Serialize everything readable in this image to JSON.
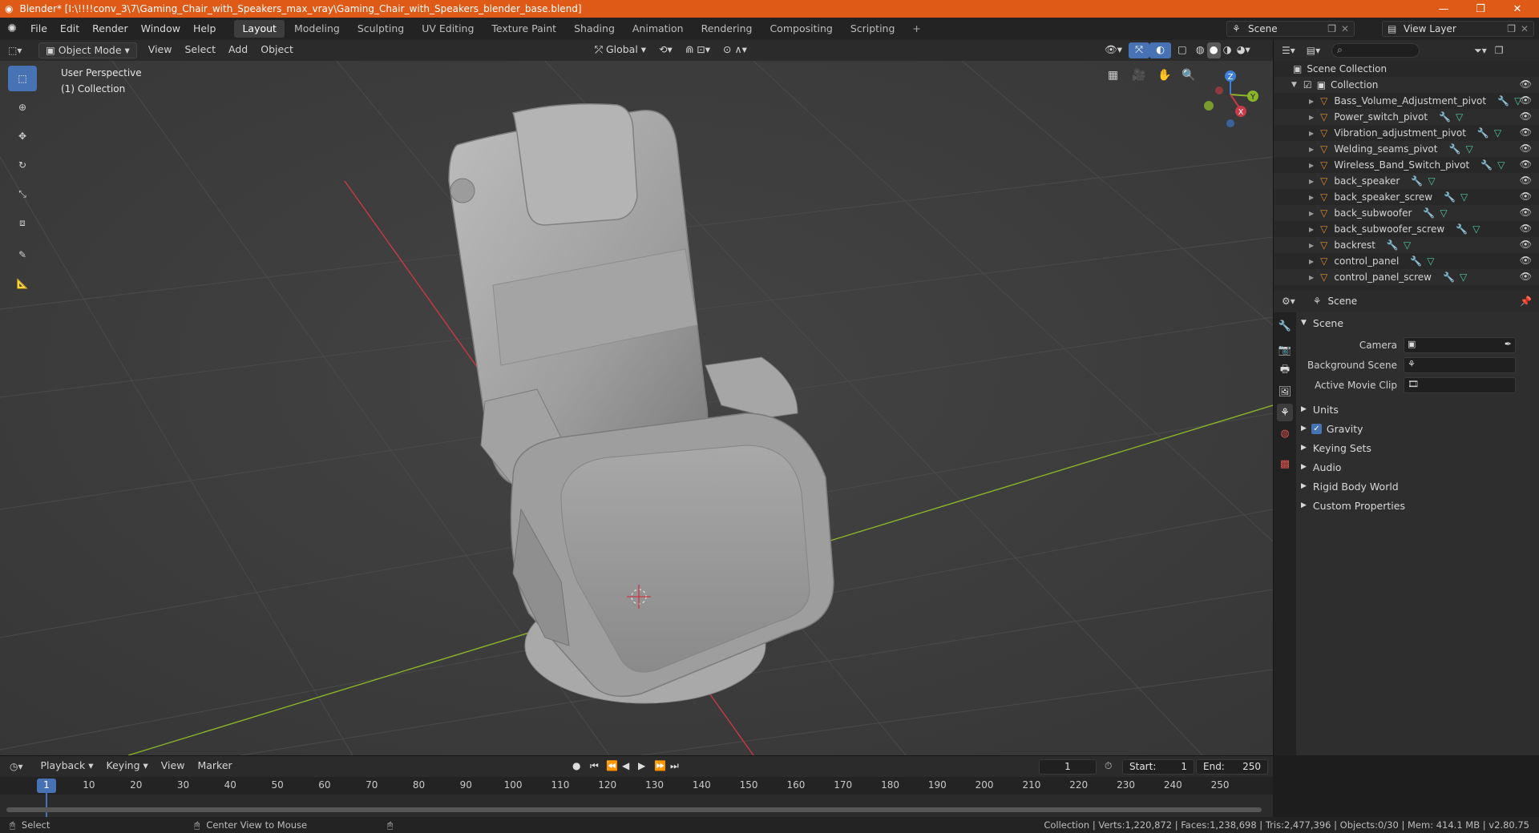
{
  "window": {
    "title": "Blender* [I:\\!!!!conv_3\\7\\Gaming_Chair_with_Speakers_max_vray\\Gaming_Chair_with_Speakers_blender_base.blend]",
    "minimize": "—",
    "restore": "❐",
    "close": "✕"
  },
  "menu": [
    "File",
    "Edit",
    "Render",
    "Window",
    "Help"
  ],
  "workspaces": [
    {
      "label": "Layout",
      "active": true
    },
    {
      "label": "Modeling"
    },
    {
      "label": "Sculpting"
    },
    {
      "label": "UV Editing"
    },
    {
      "label": "Texture Paint"
    },
    {
      "label": "Shading"
    },
    {
      "label": "Animation"
    },
    {
      "label": "Rendering"
    },
    {
      "label": "Compositing"
    },
    {
      "label": "Scripting"
    }
  ],
  "add_workspace": "+",
  "scene_selector": "Scene",
  "view_layer": "View Layer",
  "viewport_header": {
    "mode": "Object Mode",
    "menus": [
      "View",
      "Select",
      "Add",
      "Object"
    ],
    "orientation": "Global"
  },
  "viewport": {
    "perspective": "User Perspective",
    "collection": "(1) Collection",
    "gizmo": {
      "x": "X",
      "y": "Y",
      "z": "Z"
    }
  },
  "outliner": {
    "search_placeholder": "",
    "root": "Scene Collection",
    "collection": "Collection",
    "items": [
      "Bass_Volume_Adjustment_pivot",
      "Power_switch_pivot",
      "Vibration_adjustment_pivot",
      "Welding_seams_pivot",
      "Wireless_Band_Switch_pivot",
      "back_speaker",
      "back_speaker_screw",
      "back_subwoofer",
      "back_subwoofer_screw",
      "backrest",
      "control_panel",
      "control_panel_screw"
    ]
  },
  "properties": {
    "context": "Scene",
    "panel_title": "Scene",
    "camera_label": "Camera",
    "background_scene_label": "Background Scene",
    "active_movie_clip_label": "Active Movie Clip",
    "subpanels": [
      "Units",
      "Gravity",
      "Keying Sets",
      "Audio",
      "Rigid Body World",
      "Custom Properties"
    ],
    "gravity_enabled": true
  },
  "timeline": {
    "menus": [
      "Playback",
      "Keying",
      "View",
      "Marker"
    ],
    "current_frame": "1",
    "start_label": "Start:",
    "start": "1",
    "end_label": "End:",
    "end": "250",
    "ticks": [
      "1",
      "10",
      "20",
      "30",
      "40",
      "50",
      "60",
      "70",
      "80",
      "90",
      "100",
      "110",
      "120",
      "130",
      "140",
      "150",
      "160",
      "170",
      "180",
      "190",
      "200",
      "210",
      "220",
      "230",
      "240",
      "250"
    ]
  },
  "statusbar": {
    "select": "Select",
    "center_view": "Center View to Mouse",
    "stats": "Collection | Verts:1,220,872 | Faces:1,238,698 | Tris:2,477,396 | Objects:0/30 | Mem: 414.1 MB | v2.80.75"
  },
  "colors": {
    "titlebar": "#e05a17",
    "accent": "#4772b3",
    "x_axis": "#c83a45",
    "y_axis": "#8bb42a",
    "object_icon": "#e08a2e",
    "mesh_icon": "#4ec9a5"
  }
}
